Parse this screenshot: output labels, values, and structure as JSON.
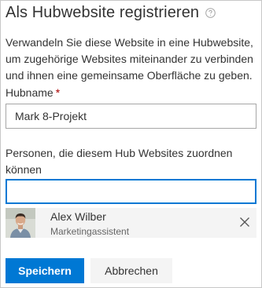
{
  "dialog": {
    "title": "Als Hubwebsite registrieren",
    "help_icon": "help-circle-icon",
    "description": "Verwandeln Sie diese Website in eine Hubwebsite, um zugehörige Websites miteinander zu verbinden und ihnen eine gemeinsame Oberfläche zu geben."
  },
  "hubname": {
    "label": "Hubname",
    "required_marker": "*",
    "value": "Mark 8-Projekt"
  },
  "people": {
    "label": "Personen, die diesem Hub Websites zuordnen können",
    "value": "",
    "selected": [
      {
        "name": "Alex Wilber",
        "title": "Marketingassistent",
        "avatar_icon": "user-photo",
        "remove_icon": "close-icon"
      }
    ]
  },
  "actions": {
    "save_label": "Speichern",
    "cancel_label": "Abbrechen"
  },
  "colors": {
    "accent": "#0078d4",
    "required": "#a80000",
    "text": "#333333",
    "muted": "#666666",
    "card_bg": "#f4f4f4"
  }
}
